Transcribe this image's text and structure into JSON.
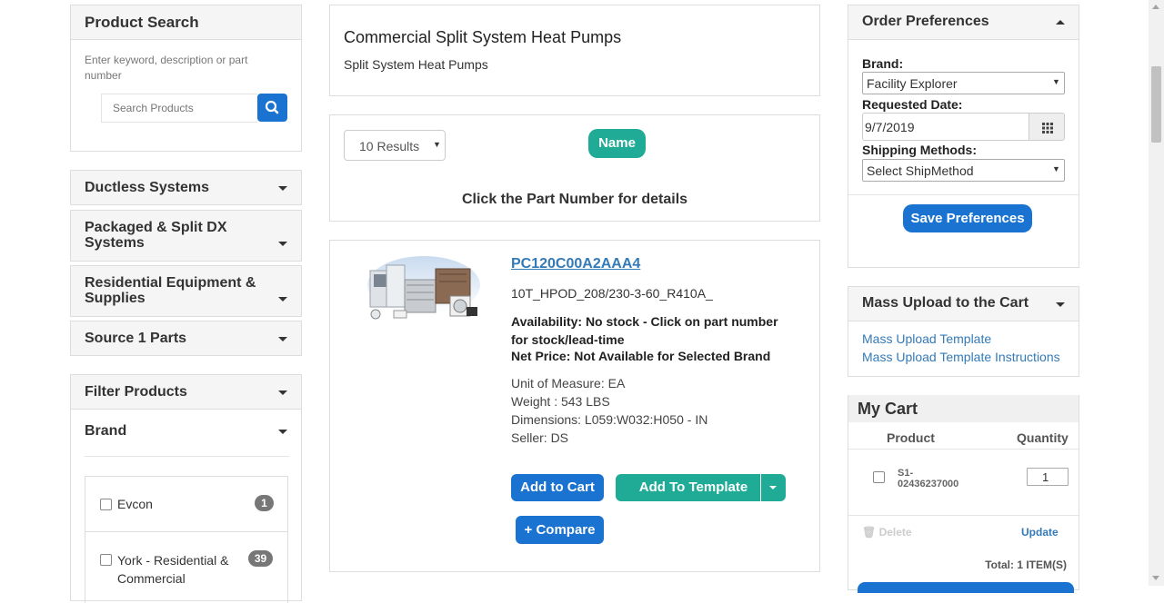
{
  "left": {
    "product_search": {
      "title": "Product Search",
      "hint": "Enter keyword, description or part number",
      "placeholder": "Search Products"
    },
    "categories": [
      {
        "label": "Ductless Systems"
      },
      {
        "label": "Packaged & Split DX Systems"
      },
      {
        "label": "Residential Equipment & Supplies"
      },
      {
        "label": "Source 1 Parts"
      }
    ],
    "filter": {
      "title": "Filter Products",
      "brand_title": "Brand",
      "brands": [
        {
          "label": "Evcon",
          "count": "1"
        },
        {
          "label": "York - Residential & Commercial",
          "count": "39"
        }
      ]
    }
  },
  "main": {
    "category": {
      "title": "Commercial Split System Heat Pumps",
      "subtitle": "Split System Heat Pumps"
    },
    "results": {
      "per_page": "10 Results",
      "sort_label": "Name",
      "hint": "Click the Part Number for details"
    },
    "product": {
      "part_number": "PC120C00A2AAA4",
      "description": "10T_HPOD_208/230-3-60_R410A_",
      "availability": "Availability: No stock - Click on part number for stock/lead-time",
      "net_price": "Net Price: Not Available for Selected Brand",
      "uom": "Unit of Measure: EA",
      "weight": "Weight : 543 LBS",
      "dimensions": "Dimensions: L059:W032:H050 - IN",
      "seller": "Seller: DS",
      "add_to_cart": "Add to Cart",
      "add_to_template": "Add To Template",
      "compare": "+ Compare"
    }
  },
  "right": {
    "order_prefs": {
      "title": "Order Preferences",
      "brand_label": "Brand:",
      "brand_value": "Facility Explorer",
      "date_label": "Requested Date:",
      "date_value": "9/7/2019",
      "ship_label": "Shipping Methods:",
      "ship_value": "Select ShipMethod",
      "save": "Save Preferences"
    },
    "mass_upload": {
      "title": "Mass Upload to the Cart",
      "link1": "Mass Upload Template",
      "link2": "Mass Upload Template Instructions"
    },
    "cart": {
      "title": "My Cart",
      "col_product": "Product",
      "col_qty": "Quantity",
      "item_line1": "S1-",
      "item_line2": "02436237000",
      "qty": "1",
      "delete": "Delete",
      "update": "Update",
      "total": "Total: 1 ITEM(S)"
    }
  },
  "icons": {
    "search": "search-icon",
    "calendar": "calendar-icon",
    "trash": "trash-icon",
    "caret": "caret-down-icon"
  },
  "colors": {
    "primary": "#1a73d1",
    "teal": "#1fab95",
    "link": "#337ab7"
  }
}
